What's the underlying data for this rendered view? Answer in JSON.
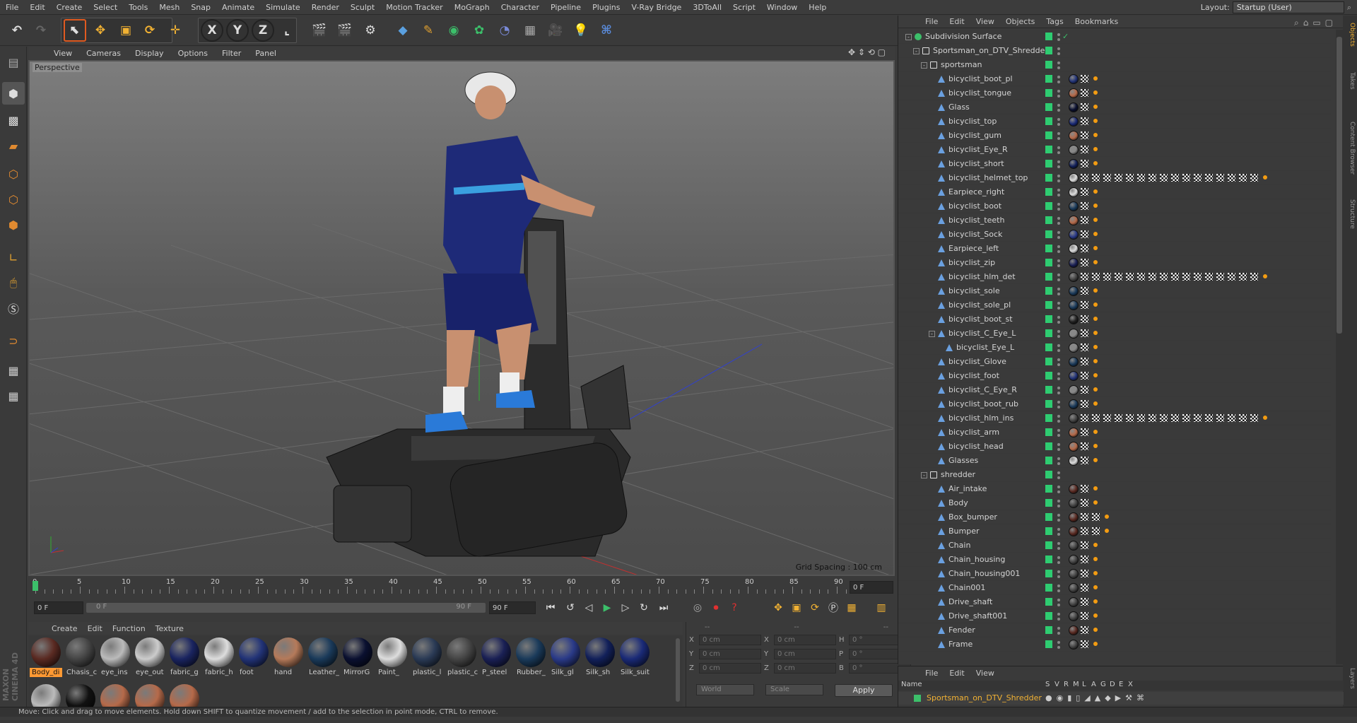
{
  "menubar": {
    "items": [
      "File",
      "Edit",
      "Create",
      "Select",
      "Tools",
      "Mesh",
      "Snap",
      "Animate",
      "Simulate",
      "Render",
      "Sculpt",
      "Motion Tracker",
      "MoGraph",
      "Character",
      "Pipeline",
      "Plugins",
      "V-Ray Bridge",
      "3DToAll",
      "Script",
      "Window",
      "Help"
    ],
    "layout_label": "Layout:",
    "layout_value": "Startup (User)"
  },
  "viewport": {
    "menu": [
      "View",
      "Cameras",
      "Display",
      "Options",
      "Filter",
      "Panel"
    ],
    "camera_label": "Perspective",
    "grid_spacing": "Grid Spacing : 100 cm"
  },
  "timeline": {
    "ticks": [
      "0",
      "5",
      "10",
      "15",
      "20",
      "25",
      "30",
      "35",
      "40",
      "45",
      "50",
      "55",
      "60",
      "65",
      "70",
      "75",
      "80",
      "85",
      "90"
    ],
    "current_frame": "0 F",
    "start_frame": "0 F",
    "range_start": "0 F",
    "range_end": "90 F",
    "end_frame": "90 F"
  },
  "materials": {
    "menu": [
      "Create",
      "Edit",
      "Function",
      "Texture"
    ],
    "items": [
      {
        "name": "Body_di",
        "color": "#5a2a22"
      },
      {
        "name": "Chasis_c",
        "color": "#444444"
      },
      {
        "name": "eye_ins",
        "color": "#bbbbbb"
      },
      {
        "name": "eye_out",
        "color": "#cccccc"
      },
      {
        "name": "fabric_g",
        "color": "#1a2460"
      },
      {
        "name": "fabric_h",
        "color": "#dddddd"
      },
      {
        "name": "foot",
        "color": "#223377"
      },
      {
        "name": "hand",
        "color": "#b57a5a"
      },
      {
        "name": "Leather_",
        "color": "#1a3a5a"
      },
      {
        "name": "MirrorG",
        "color": "#0a1030"
      },
      {
        "name": "Paint_",
        "color": "#dddddd"
      },
      {
        "name": "plastic_l",
        "color": "#2a3a55"
      },
      {
        "name": "plastic_c",
        "color": "#444444"
      },
      {
        "name": "P_steel",
        "color": "#1a2055"
      },
      {
        "name": "Rubber_",
        "color": "#1a3a5a"
      },
      {
        "name": "Silk_gl",
        "color": "#2a3a88"
      },
      {
        "name": "Silk_sh",
        "color": "#12205a"
      },
      {
        "name": "Silk_suit",
        "color": "#1a2a77"
      }
    ],
    "row2": [
      {
        "color": "#bbbbbb"
      },
      {
        "color": "#111111"
      },
      {
        "color": "#b56a4a"
      },
      {
        "color": "#b56a4a"
      },
      {
        "color": "#b56a4a"
      }
    ]
  },
  "coords": {
    "header_left": "--",
    "header_mid": "--",
    "header_right": "--",
    "rows": [
      {
        "a": "X",
        "av": "0 cm",
        "b": "X",
        "bv": "0 cm",
        "c": "H",
        "cv": "0 °"
      },
      {
        "a": "Y",
        "av": "0 cm",
        "b": "Y",
        "bv": "0 cm",
        "c": "P",
        "cv": "0 °"
      },
      {
        "a": "Z",
        "av": "0 cm",
        "b": "Z",
        "bv": "0 cm",
        "c": "B",
        "cv": "0 °"
      }
    ],
    "space": "World",
    "mode": "Scale",
    "apply": "Apply"
  },
  "objmgr": {
    "menu": [
      "File",
      "Edit",
      "View",
      "Objects",
      "Tags",
      "Bookmarks"
    ],
    "rows": [
      {
        "name": "Subdivision Surface",
        "depth": 0,
        "type": "subd",
        "tog": "-",
        "tags": "subd"
      },
      {
        "name": "Sportsman_on_DTV_Shredder",
        "depth": 1,
        "type": "null",
        "tog": "-",
        "tags": ""
      },
      {
        "name": "sportsman",
        "depth": 2,
        "type": "null",
        "tog": "-",
        "tags": ""
      },
      {
        "name": "bicyclist_boot_pl",
        "depth": 3,
        "type": "bone",
        "m": "#223377",
        "tags": "1"
      },
      {
        "name": "bicyclist_tongue",
        "depth": 3,
        "type": "bone",
        "m": "#b56a4a",
        "tags": "1"
      },
      {
        "name": "Glass",
        "depth": 3,
        "type": "bone",
        "m": "#0a1030",
        "tags": "1"
      },
      {
        "name": "bicyclist_top",
        "depth": 3,
        "type": "bone",
        "m": "#1a2a77",
        "tags": "1"
      },
      {
        "name": "bicyclist_gum",
        "depth": 3,
        "type": "bone",
        "m": "#b56a4a",
        "tags": "1"
      },
      {
        "name": "bicyclist_Eye_R",
        "depth": 3,
        "type": "bone",
        "m": "#888888",
        "tags": "1"
      },
      {
        "name": "bicyclist_short",
        "depth": 3,
        "type": "bone",
        "m": "#12205a",
        "tags": "1"
      },
      {
        "name": "bicyclist_helmet_top",
        "depth": 3,
        "type": "bone",
        "m": "#dddddd",
        "tags": "many"
      },
      {
        "name": "Earpiece_right",
        "depth": 3,
        "type": "bone",
        "m": "#dddddd",
        "tags": "1"
      },
      {
        "name": "bicyclist_boot",
        "depth": 3,
        "type": "bone",
        "m": "#1a3a5a",
        "tags": "1"
      },
      {
        "name": "bicyclist_teeth",
        "depth": 3,
        "type": "bone",
        "m": "#b56a4a",
        "tags": "1"
      },
      {
        "name": "bicyclist_Sock",
        "depth": 3,
        "type": "bone",
        "m": "#2a3a88",
        "tags": "1"
      },
      {
        "name": "Earpiece_left",
        "depth": 3,
        "type": "bone",
        "m": "#dddddd",
        "tags": "1"
      },
      {
        "name": "bicyclist_zip",
        "depth": 3,
        "type": "bone",
        "m": "#1a2055",
        "tags": "1"
      },
      {
        "name": "bicyclist_hlm_det",
        "depth": 3,
        "type": "bone",
        "m": "#444444",
        "tags": "many"
      },
      {
        "name": "bicyclist_sole",
        "depth": 3,
        "type": "bone",
        "m": "#1a3a5a",
        "tags": "1"
      },
      {
        "name": "bicyclist_sole_pl",
        "depth": 3,
        "type": "bone",
        "m": "#1a3a5a",
        "tags": "1"
      },
      {
        "name": "bicyclist_boot_st",
        "depth": 3,
        "type": "bone",
        "m": "#222222",
        "tags": "1"
      },
      {
        "name": "bicyclist_C_Eye_L",
        "depth": 3,
        "type": "bone",
        "tog": "-",
        "m": "#888888",
        "tags": "1"
      },
      {
        "name": "bicyclist_Eye_L",
        "depth": 4,
        "type": "bone",
        "m": "#888888",
        "tags": "1"
      },
      {
        "name": "bicyclist_Glove",
        "depth": 3,
        "type": "bone",
        "m": "#1a3a5a",
        "tags": "1"
      },
      {
        "name": "bicyclist_foot",
        "depth": 3,
        "type": "bone",
        "m": "#223377",
        "tags": "1"
      },
      {
        "name": "bicyclist_C_Eye_R",
        "depth": 3,
        "type": "bone",
        "m": "#888888",
        "tags": "1"
      },
      {
        "name": "bicyclist_boot_rub",
        "depth": 3,
        "type": "bone",
        "m": "#1a3a5a",
        "tags": "1"
      },
      {
        "name": "bicyclist_hlm_ins",
        "depth": 3,
        "type": "bone",
        "m": "#444444",
        "tags": "many"
      },
      {
        "name": "bicyclist_arm",
        "depth": 3,
        "type": "bone",
        "m": "#b56a4a",
        "tags": "1"
      },
      {
        "name": "bicyclist_head",
        "depth": 3,
        "type": "bone",
        "m": "#b56a4a",
        "tags": "1"
      },
      {
        "name": "Glasses",
        "depth": 3,
        "type": "bone",
        "m": "#dddddd",
        "tags": "1"
      },
      {
        "name": "shredder",
        "depth": 2,
        "type": "null",
        "tog": "-",
        "tags": ""
      },
      {
        "name": "Air_intake",
        "depth": 3,
        "type": "bone",
        "m": "#5a2a22",
        "tags": "1"
      },
      {
        "name": "Body",
        "depth": 3,
        "type": "bone",
        "m": "#444444",
        "tags": "1"
      },
      {
        "name": "Box_bumper",
        "depth": 3,
        "type": "bone",
        "m": "#5a2a22",
        "tags": "2"
      },
      {
        "name": "Bumper",
        "depth": 3,
        "type": "bone",
        "m": "#5a2a22",
        "tags": "2"
      },
      {
        "name": "Chain",
        "depth": 3,
        "type": "bone",
        "m": "#444444",
        "tags": "1"
      },
      {
        "name": "Chain_housing",
        "depth": 3,
        "type": "bone",
        "m": "#444444",
        "tags": "1"
      },
      {
        "name": "Chain_housing001",
        "depth": 3,
        "type": "bone",
        "m": "#444444",
        "tags": "1"
      },
      {
        "name": "Chain001",
        "depth": 3,
        "type": "bone",
        "m": "#444444",
        "tags": "1"
      },
      {
        "name": "Drive_shaft",
        "depth": 3,
        "type": "bone",
        "m": "#444444",
        "tags": "1"
      },
      {
        "name": "Drive_shaft001",
        "depth": 3,
        "type": "bone",
        "m": "#444444",
        "tags": "1"
      },
      {
        "name": "Fender",
        "depth": 3,
        "type": "bone",
        "m": "#5a2a22",
        "tags": "1"
      },
      {
        "name": "Frame",
        "depth": 3,
        "type": "bone",
        "m": "#444444",
        "tags": "1"
      }
    ]
  },
  "layers": {
    "menu": [
      "File",
      "Edit",
      "View"
    ],
    "columns": [
      "Name",
      "S",
      "V",
      "R",
      "M",
      "L",
      "A",
      "G",
      "D",
      "E",
      "X"
    ],
    "row_name": "Sportsman_on_DTV_Shredder"
  },
  "sidetabs": [
    "Objects",
    "Takes",
    "Content Browser",
    "Structure"
  ],
  "layers_tab": "Layers",
  "status": "Move: Click and drag to move elements. Hold down SHIFT to quantize movement / add to the selection in point mode, CTRL to remove.",
  "brand": "MAXON CINEMA 4D"
}
